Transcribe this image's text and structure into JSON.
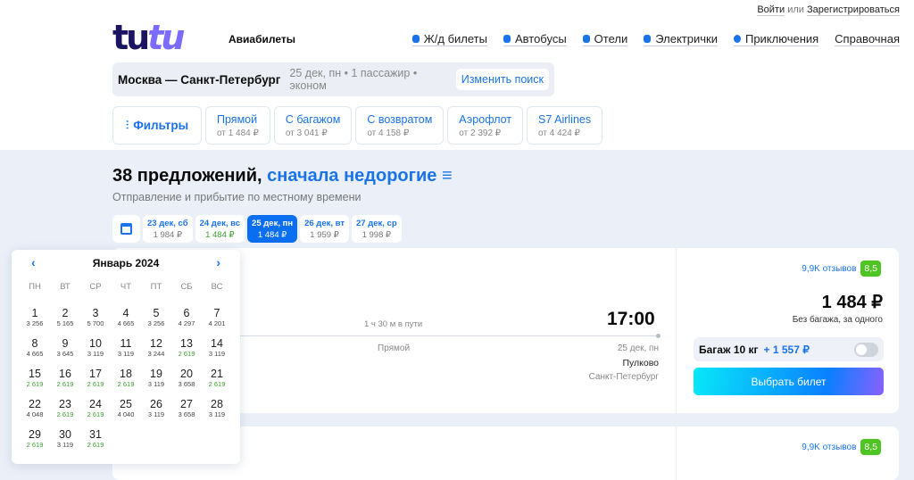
{
  "auth": {
    "login": "Войти",
    "or": "или",
    "register": "Зарегистрироваться"
  },
  "logo": {
    "part1": "tu",
    "part2": "tu",
    "subtitle": "Авиабилеты"
  },
  "nav": [
    {
      "label": "Ж/д билеты",
      "icon": "train-icon"
    },
    {
      "label": "Автобусы",
      "icon": "bus-icon"
    },
    {
      "label": "Отели",
      "icon": "bed-icon"
    },
    {
      "label": "Электрички",
      "icon": "suburban-train-icon"
    },
    {
      "label": "Приключения",
      "icon": "pin-icon"
    },
    {
      "label": "Справочная",
      "icon": ""
    }
  ],
  "search": {
    "route": "Москва — Санкт-Петербург",
    "meta": "25 дек, пн • 1 пассажир • эконом",
    "change": "Изменить поиск"
  },
  "filters": {
    "main": "Фильтры",
    "items": [
      {
        "label": "Прямой",
        "price": "от 1 484 ₽"
      },
      {
        "label": "С багажом",
        "price": "от 3 041 ₽"
      },
      {
        "label": "С возвратом",
        "price": "от 4 158 ₽"
      },
      {
        "label": "Аэрофлот",
        "price": "от 2 392 ₽"
      },
      {
        "label": "S7 Airlines",
        "price": "от 4 424 ₽"
      }
    ]
  },
  "results": {
    "count": "38 предложений,",
    "sort": "сначала недорогие",
    "note": "Отправление и прибытие по местному времени"
  },
  "dates": [
    {
      "label": "23 дек, сб",
      "price": "1 984 ₽"
    },
    {
      "label": "24 дек, вс",
      "price": "1 484 ₽",
      "cheap": true
    },
    {
      "label": "25 дек, пн",
      "price": "1 484 ₽",
      "active": true
    },
    {
      "label": "26 дек, вт",
      "price": "1 959 ₽"
    },
    {
      "label": "27 дек, ср",
      "price": "1 998 ₽"
    }
  ],
  "calendar": {
    "month": "Январь 2024",
    "weekdays": [
      "ПН",
      "ВТ",
      "СР",
      "ЧТ",
      "ПТ",
      "СБ",
      "ВС"
    ],
    "days": [
      [
        "1",
        "3 256",
        0
      ],
      [
        "2",
        "5 165",
        0
      ],
      [
        "3",
        "5 700",
        0
      ],
      [
        "4",
        "4 665",
        0
      ],
      [
        "5",
        "3 256",
        0
      ],
      [
        "6",
        "4 297",
        0
      ],
      [
        "7",
        "4 201",
        0
      ],
      [
        "8",
        "4 665",
        0
      ],
      [
        "9",
        "3 645",
        0
      ],
      [
        "10",
        "3 119",
        0
      ],
      [
        "11",
        "3 119",
        0
      ],
      [
        "12",
        "3 244",
        0
      ],
      [
        "13",
        "2 619",
        1
      ],
      [
        "14",
        "3 119",
        0
      ],
      [
        "15",
        "2 619",
        1
      ],
      [
        "16",
        "2 619",
        1
      ],
      [
        "17",
        "2 619",
        1
      ],
      [
        "18",
        "2 619",
        1
      ],
      [
        "19",
        "3 119",
        0
      ],
      [
        "20",
        "3 658",
        0
      ],
      [
        "21",
        "2 619",
        1
      ],
      [
        "22",
        "4 048",
        0
      ],
      [
        "23",
        "2 619",
        1
      ],
      [
        "24",
        "2 619",
        1
      ],
      [
        "25",
        "4 040",
        0
      ],
      [
        "26",
        "3 119",
        0
      ],
      [
        "27",
        "3 658",
        0
      ],
      [
        "28",
        "3 119",
        0
      ],
      [
        "29",
        "2 619",
        1
      ],
      [
        "30",
        "3 119",
        0
      ],
      [
        "31",
        "2 619",
        1
      ]
    ]
  },
  "ticket": {
    "duration": "1 ч 30 м в пути",
    "arrival_time": "17:00",
    "type": "Прямой",
    "arrival_date": "25 дек, пн",
    "airport": "Пулково",
    "city": "Санкт-Петербург",
    "reviews": "9,9K отзывов",
    "rating": "8,5",
    "price": "1 484 ₽",
    "price_note": "Без багажа, за одного",
    "baggage": "Багаж 10 кг",
    "baggage_price": "+ 1 557 ₽",
    "buy": "Выбрать билет"
  },
  "ticket2": {
    "reviews": "9,9K отзывов",
    "rating": "8,5"
  }
}
